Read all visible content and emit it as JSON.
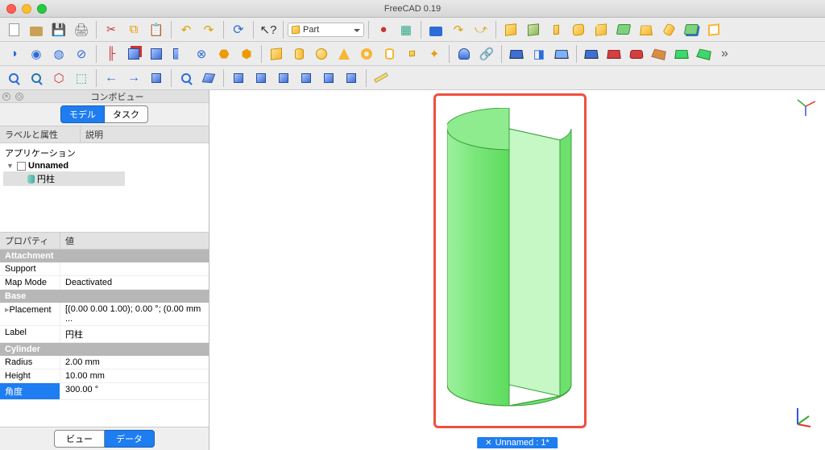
{
  "window": {
    "title": "FreeCAD 0.19"
  },
  "workbench": {
    "selected": "Part"
  },
  "combo": {
    "title": "コンボビュー",
    "tab_model": "モデル",
    "tab_task": "タスク",
    "col_labels": "ラベルと属性",
    "col_desc": "説明",
    "root": "アプリケーション",
    "doc": "Unnamed",
    "item": "円柱"
  },
  "props": {
    "col_name": "プロパティ",
    "col_val": "値",
    "groups": {
      "attachment": "Attachment",
      "base": "Base",
      "cylinder": "Cylinder"
    },
    "rows": {
      "support": {
        "n": "Support",
        "v": ""
      },
      "mapmode": {
        "n": "Map Mode",
        "v": "Deactivated"
      },
      "placement": {
        "n": "Placement",
        "v": "[(0.00 0.00 1.00); 0.00 °; (0.00 mm ..."
      },
      "label": {
        "n": "Label",
        "v": "円柱"
      },
      "radius": {
        "n": "Radius",
        "v": "2.00 mm"
      },
      "height": {
        "n": "Height",
        "v": "10.00 mm"
      },
      "angle": {
        "n": "角度",
        "v": "300.00 °"
      }
    }
  },
  "bottom_tabs": {
    "view": "ビュー",
    "data": "データ"
  },
  "status": {
    "label": "Unnamed : 1*"
  }
}
